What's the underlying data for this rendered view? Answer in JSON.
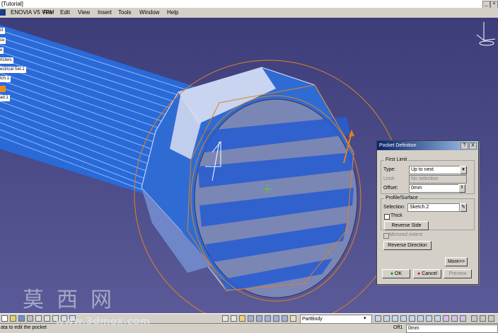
{
  "window": {
    "title": "[Tutorial]"
  },
  "menu": [
    "ENOVIA V5 VPM",
    "File",
    "Edit",
    "View",
    "Insert",
    "Tools",
    "Window",
    "Help"
  ],
  "tree": [
    "ct",
    "ce",
    "e",
    "rtcters",
    "ectrical Set.1",
    "tch.1",
    "ad.1"
  ],
  "dialog": {
    "title": "Pocket Definition",
    "help_btn": "?",
    "close_btn": "X",
    "first_limit_label": "First Limit",
    "type_label": "Type:",
    "type_value": "Up to next",
    "limit_label": "Limit:",
    "limit_value": "No selection",
    "offset_label": "Offset:",
    "offset_value": "0mm",
    "profile_label": "Profile/Surface",
    "selection_label": "Selection:",
    "selection_value": "Sketch.2",
    "thick_label": "Thick",
    "reverse_side": "Reverse Side",
    "mirrored_extent": "Mirrored extent",
    "reverse_direction": "Reverse Direction",
    "more": "More>>",
    "ok": "OK",
    "cancel": "Cancel",
    "preview": "Preview"
  },
  "toolbar": {
    "partbody": "PartBody"
  },
  "status": {
    "message": "ata to edit the pocket",
    "offset_label": "Off1",
    "offset_value": "0mm"
  },
  "watermark": {
    "chars": "莫西网",
    "url": "www.3dmox.com"
  }
}
